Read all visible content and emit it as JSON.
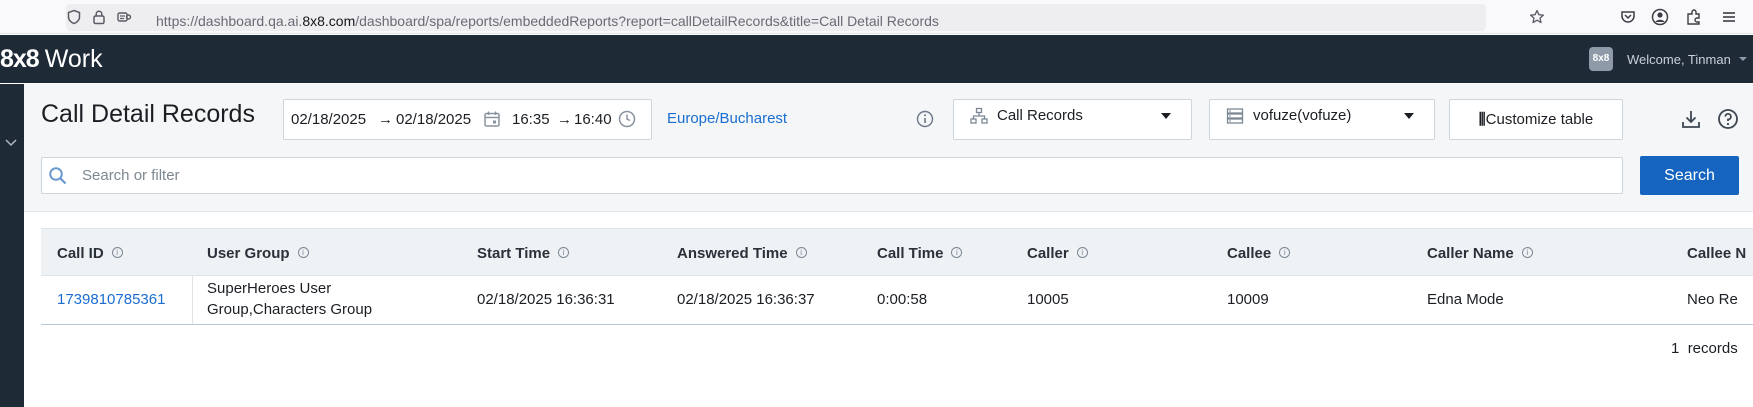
{
  "browser": {
    "url_prefix": "https://dashboard.qa.ai.",
    "url_domain": "8x8.com",
    "url_path": "/dashboard/spa/reports/embeddedReports?report=callDetailRecords&title=Call Detail Records"
  },
  "header": {
    "logo_mark": "8x8",
    "logo_text": "Work",
    "avatar_text": "8x8",
    "welcome": "Welcome, Tinman"
  },
  "toolbar": {
    "title": "Call Detail Records",
    "date_from": "02/18/2025",
    "date_to": "02/18/2025",
    "time_from": "16:35",
    "time_to": "16:40",
    "arrow": "→",
    "timezone": "Europe/Bucharest",
    "report_type": "Call Records",
    "tenant": "vofuze(vofuze)",
    "customize_label": "Customize table"
  },
  "search": {
    "placeholder": "Search or filter",
    "button": "Search"
  },
  "table": {
    "columns": [
      "Call ID",
      "User Group",
      "Start Time",
      "Answered Time",
      "Call Time",
      "Caller",
      "Callee",
      "Caller Name",
      "Callee N"
    ],
    "rows": [
      {
        "call_id": "1739810785361",
        "user_group_line1": "SuperHeroes User",
        "user_group_line2": "Group,Characters Group",
        "start_time": "02/18/2025 16:36:31",
        "answered_time": "02/18/2025 16:36:37",
        "call_time": "0:00:58",
        "caller": "10005",
        "callee": "10009",
        "caller_name": "Edna Mode",
        "callee_name": "Neo Re"
      }
    ],
    "records_count": "1",
    "records_label": "records"
  },
  "icons": [
    "shield-icon",
    "lock-icon",
    "permissions-icon",
    "star-icon",
    "pocket-icon",
    "account-icon",
    "extensions-icon",
    "menu-icon",
    "calendar-icon",
    "clock-icon",
    "info-icon",
    "hierarchy-icon",
    "server-icon",
    "download-icon",
    "help-icon",
    "search-icon",
    "chevron-down-icon"
  ],
  "colors": {
    "header_bg": "#1e2a36",
    "accent": "#1565c0",
    "link": "#1a6dd0"
  }
}
